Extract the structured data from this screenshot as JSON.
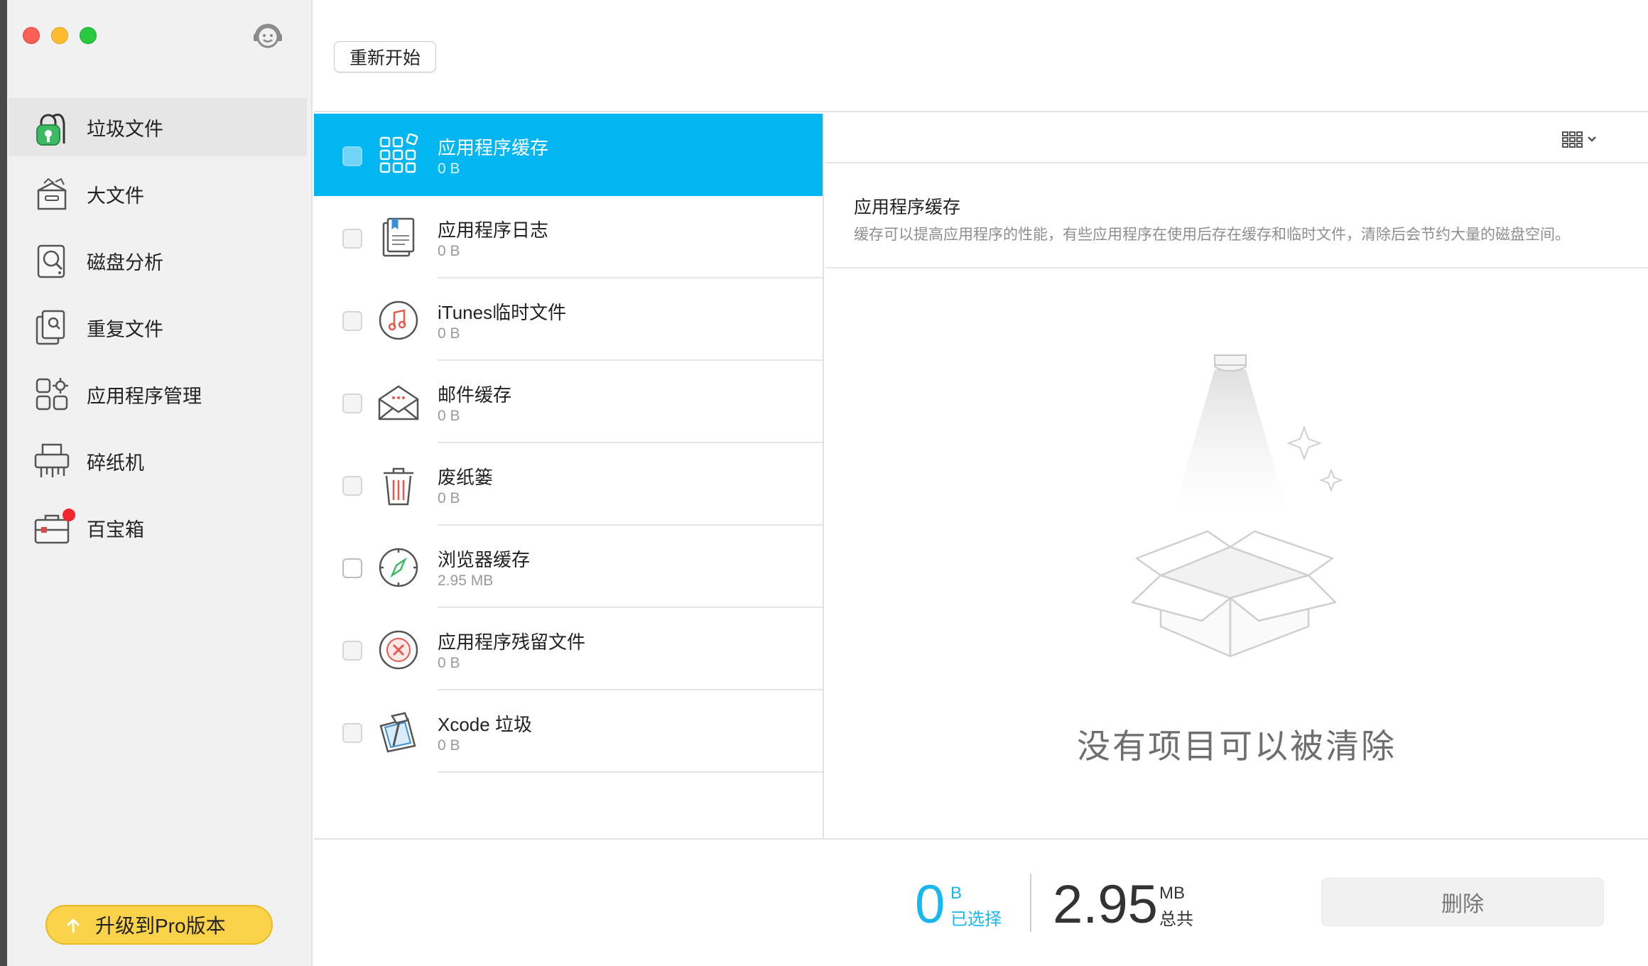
{
  "sidebar": {
    "items": [
      {
        "label": "垃圾文件",
        "icon": "vacuum-icon",
        "active": true
      },
      {
        "label": "大文件",
        "icon": "large-files-box-icon"
      },
      {
        "label": "磁盘分析",
        "icon": "disk-analysis-icon"
      },
      {
        "label": "重复文件",
        "icon": "duplicate-files-icon"
      },
      {
        "label": "应用程序管理",
        "icon": "app-manager-icon"
      },
      {
        "label": "碎纸机",
        "icon": "shredder-icon"
      },
      {
        "label": "百宝箱",
        "icon": "toolbox-icon",
        "badge": true
      }
    ],
    "upgrade_label": "升级到Pro版本"
  },
  "toolbar": {
    "restart_label": "重新开始"
  },
  "list": {
    "items": [
      {
        "title": "应用程序缓存",
        "size": "0 B",
        "icon": "app-cache-grid-icon",
        "selected": true
      },
      {
        "title": "应用程序日志",
        "size": "0 B",
        "icon": "app-log-document-icon"
      },
      {
        "title": "iTunes临时文件",
        "size": "0 B",
        "icon": "itunes-music-icon"
      },
      {
        "title": "邮件缓存",
        "size": "0 B",
        "icon": "mail-envelope-icon"
      },
      {
        "title": "废纸篓",
        "size": "0 B",
        "icon": "trash-icon"
      },
      {
        "title": "浏览器缓存",
        "size": "2.95 MB",
        "icon": "browser-compass-icon"
      },
      {
        "title": "应用程序残留文件",
        "size": "0 B",
        "icon": "app-leftover-x-icon"
      },
      {
        "title": "Xcode 垃圾",
        "size": "0 B",
        "icon": "xcode-hammer-icon"
      }
    ]
  },
  "detail": {
    "title": "应用程序缓存",
    "description": "缓存可以提高应用程序的性能，有些应用程序在使用后存在缓存和临时文件，清除后会节约大量的磁盘空间。",
    "empty_message": "没有项目可以被清除"
  },
  "footer": {
    "selected_value": "0",
    "selected_unit": "B",
    "selected_label": "已选择",
    "total_value": "2.95",
    "total_unit": "MB",
    "total_label": "总共",
    "delete_label": "删除"
  },
  "colors": {
    "accent": "#02b6f2",
    "upgrade": "#fbd34a",
    "badge": "#f2262d",
    "vacuum_green": "#3dbb64"
  }
}
